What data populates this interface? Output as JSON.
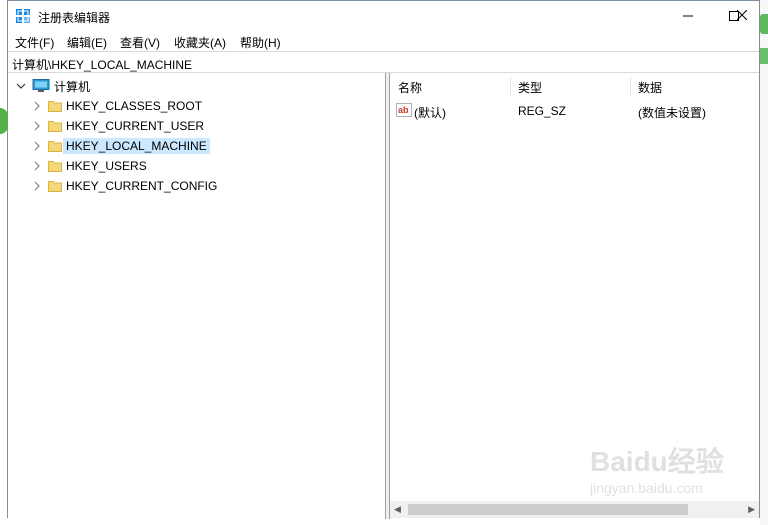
{
  "window": {
    "title": "注册表编辑器",
    "controls": {
      "minimize": "minimize-icon",
      "maximize": "maximize-icon",
      "close": "close-icon"
    }
  },
  "menu": {
    "items": [
      {
        "label": "文件(F)"
      },
      {
        "label": "编辑(E)"
      },
      {
        "label": "查看(V)"
      },
      {
        "label": "收藏夹(A)"
      },
      {
        "label": "帮助(H)"
      }
    ]
  },
  "address": {
    "path": "计算机\\HKEY_LOCAL_MACHINE"
  },
  "tree": {
    "root_label": "计算机",
    "children": [
      {
        "label": "HKEY_CLASSES_ROOT"
      },
      {
        "label": "HKEY_CURRENT_USER"
      },
      {
        "label": "HKEY_LOCAL_MACHINE",
        "selected": true
      },
      {
        "label": "HKEY_USERS"
      },
      {
        "label": "HKEY_CURRENT_CONFIG"
      }
    ]
  },
  "list": {
    "columns": [
      {
        "label": "名称"
      },
      {
        "label": "类型"
      },
      {
        "label": "数据"
      }
    ],
    "rows": [
      {
        "name": "(默认)",
        "type": "REG_SZ",
        "data": "(数值未设置)",
        "icon": "ab"
      }
    ]
  },
  "watermark": {
    "text": "Baidu经验",
    "sub": "jingyan.baidu.com"
  },
  "colors": {
    "selection": "#cce8ff",
    "folder": "#f5d77a",
    "border": "#a0a0a0"
  }
}
